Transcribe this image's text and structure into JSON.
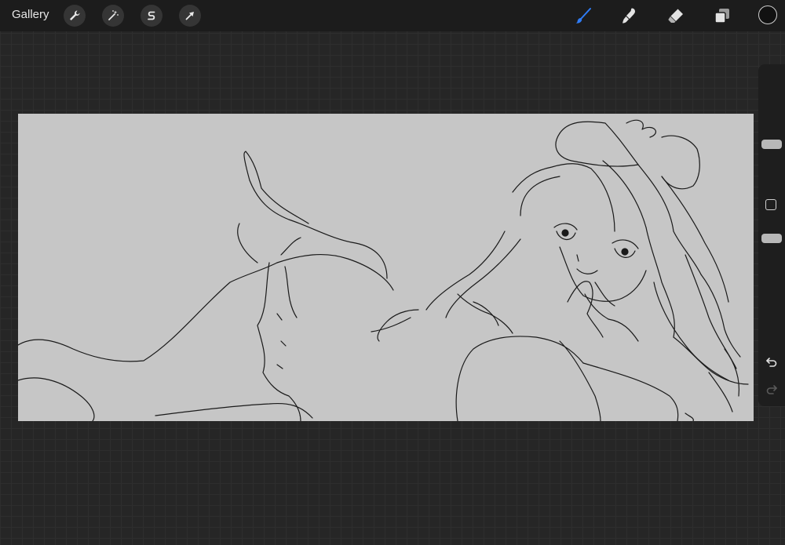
{
  "topbar": {
    "gallery_label": "Gallery",
    "left_tools": [
      {
        "icon": "wrench-icon",
        "name": "actions"
      },
      {
        "icon": "magic-wand-icon",
        "name": "adjustments"
      },
      {
        "icon": "selection-s-icon",
        "name": "selection"
      },
      {
        "icon": "arrow-cursor-icon",
        "name": "transform"
      }
    ],
    "right_tools": [
      {
        "icon": "brush-icon",
        "name": "paint",
        "active": true
      },
      {
        "icon": "smudge-icon",
        "name": "smudge",
        "active": false
      },
      {
        "icon": "eraser-icon",
        "name": "erase",
        "active": false
      },
      {
        "icon": "layers-icon",
        "name": "layers",
        "active": false
      }
    ],
    "current_color": "#111111"
  },
  "colors": {
    "accent": "#2f7cf6",
    "canvas_bg": "#c6c6c6",
    "workspace_bg": "#262626",
    "topbar_bg": "#1c1c1c",
    "sidebar_bg": "#1e1e1e"
  },
  "sidebar": {
    "brush_size_level": 0.25,
    "opacity_level": 0.7,
    "controls": [
      "modify-button",
      "undo-button",
      "redo-button"
    ]
  }
}
